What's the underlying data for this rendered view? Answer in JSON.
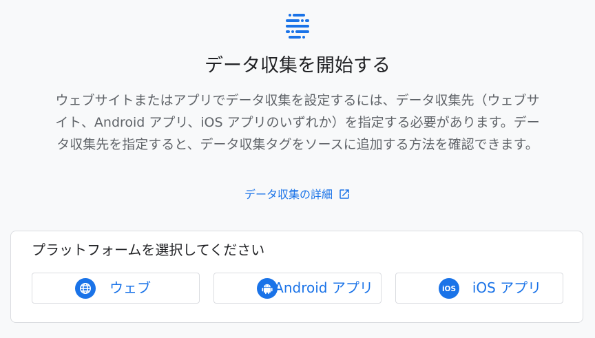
{
  "header": {
    "icon": "data-stream-icon",
    "title": "データ収集を開始する",
    "description": "ウェブサイトまたはアプリでデータ収集を設定するには、データ収集先（ウェブサイト、Android アプリ、iOS アプリのいずれか）を指定する必要があります。データ収集先を指定すると、データ収集タグをソースに追加する方法を確認できます。",
    "learn_more_label": "データ収集の詳細",
    "learn_more_icon": "open-in-new-icon"
  },
  "platform_card": {
    "title": "プラットフォームを選択してください",
    "buttons": [
      {
        "label": "ウェブ",
        "icon": "globe-icon"
      },
      {
        "label": "Android アプリ",
        "icon": "android-icon"
      },
      {
        "label": "iOS アプリ",
        "icon": "ios-icon"
      }
    ]
  },
  "colors": {
    "accent": "#1a73e8",
    "background": "#f8f9fa",
    "card_border": "#dadce0",
    "title_text": "#202124",
    "body_text": "#5f6368"
  }
}
